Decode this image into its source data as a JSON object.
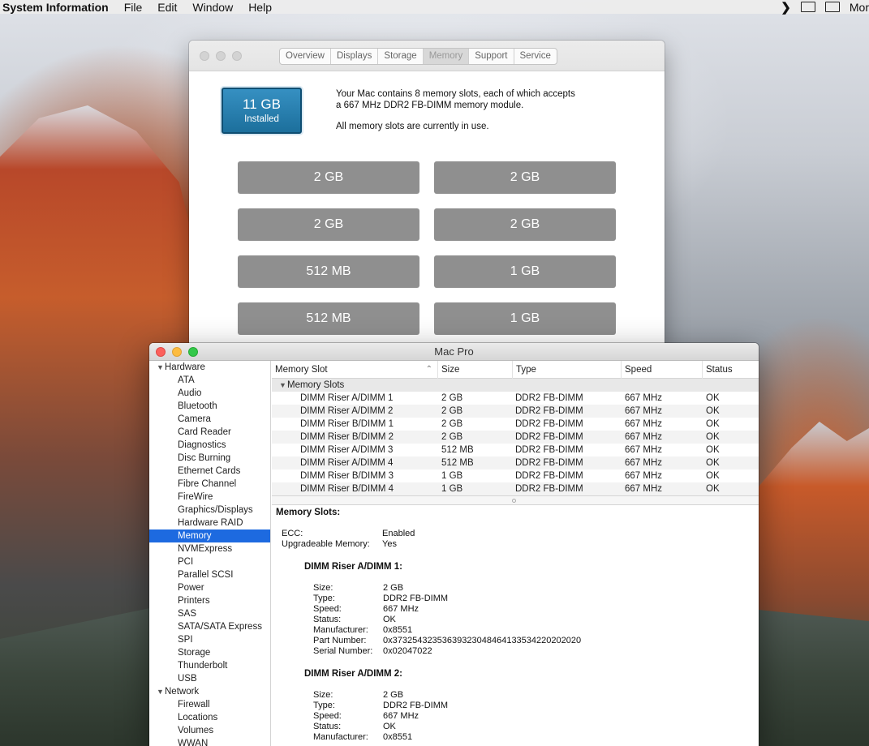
{
  "menubar": {
    "app_name": "System Information",
    "menus": [
      "File",
      "Edit",
      "Window",
      "Help"
    ],
    "right_text": "Mor"
  },
  "about": {
    "tabs": [
      "Overview",
      "Displays",
      "Storage",
      "Memory",
      "Support",
      "Service"
    ],
    "active_tab": "Memory",
    "badge_amount": "11 GB",
    "badge_label": "Installed",
    "desc_line1": "Your Mac contains 8 memory slots, each of which accepts",
    "desc_line2": "a 667 MHz DDR2 FB-DIMM memory module.",
    "desc_line3": "All memory slots are currently in use.",
    "slots": [
      "2 GB",
      "2 GB",
      "2 GB",
      "2 GB",
      "512 MB",
      "1 GB",
      "512 MB",
      "1 GB"
    ]
  },
  "sysinfo": {
    "window_title": "Mac Pro",
    "sidebar": {
      "hardware_label": "Hardware",
      "hardware_items": [
        "ATA",
        "Audio",
        "Bluetooth",
        "Camera",
        "Card Reader",
        "Diagnostics",
        "Disc Burning",
        "Ethernet Cards",
        "Fibre Channel",
        "FireWire",
        "Graphics/Displays",
        "Hardware RAID",
        "Memory",
        "NVMExpress",
        "PCI",
        "Parallel SCSI",
        "Power",
        "Printers",
        "SAS",
        "SATA/SATA Express",
        "SPI",
        "Storage",
        "Thunderbolt",
        "USB"
      ],
      "selected": "Memory",
      "network_label": "Network",
      "network_items": [
        "Firewall",
        "Locations",
        "Volumes",
        "WWAN"
      ]
    },
    "columns": [
      "Memory Slot",
      "Size",
      "Type",
      "Speed",
      "Status"
    ],
    "group_label": "Memory Slots",
    "rows": [
      [
        "DIMM Riser A/DIMM 1",
        "2 GB",
        "DDR2 FB-DIMM",
        "667 MHz",
        "OK"
      ],
      [
        "DIMM Riser A/DIMM 2",
        "2 GB",
        "DDR2 FB-DIMM",
        "667 MHz",
        "OK"
      ],
      [
        "DIMM Riser B/DIMM 1",
        "2 GB",
        "DDR2 FB-DIMM",
        "667 MHz",
        "OK"
      ],
      [
        "DIMM Riser B/DIMM 2",
        "2 GB",
        "DDR2 FB-DIMM",
        "667 MHz",
        "OK"
      ],
      [
        "DIMM Riser A/DIMM 3",
        "512 MB",
        "DDR2 FB-DIMM",
        "667 MHz",
        "OK"
      ],
      [
        "DIMM Riser A/DIMM 4",
        "512 MB",
        "DDR2 FB-DIMM",
        "667 MHz",
        "OK"
      ],
      [
        "DIMM Riser B/DIMM 3",
        "1 GB",
        "DDR2 FB-DIMM",
        "667 MHz",
        "OK"
      ],
      [
        "DIMM Riser B/DIMM 4",
        "1 GB",
        "DDR2 FB-DIMM",
        "667 MHz",
        "OK"
      ]
    ],
    "detail": {
      "heading": "Memory Slots:",
      "ecc_label": "ECC:",
      "ecc_value": "Enabled",
      "upgradeable_label": "Upgradeable Memory:",
      "upgradeable_value": "Yes",
      "dimms": [
        {
          "title": "DIMM Riser A/DIMM 1:",
          "fields": [
            [
              "Size:",
              "2 GB"
            ],
            [
              "Type:",
              "DDR2 FB-DIMM"
            ],
            [
              "Speed:",
              "667 MHz"
            ],
            [
              "Status:",
              "OK"
            ],
            [
              "Manufacturer:",
              "0x8551"
            ],
            [
              "Part Number:",
              "0x37325432353639323048464133534220202020"
            ],
            [
              "Serial Number:",
              "0x02047022"
            ]
          ]
        },
        {
          "title": "DIMM Riser A/DIMM 2:",
          "fields": [
            [
              "Size:",
              "2 GB"
            ],
            [
              "Type:",
              "DDR2 FB-DIMM"
            ],
            [
              "Speed:",
              "667 MHz"
            ],
            [
              "Status:",
              "OK"
            ],
            [
              "Manufacturer:",
              "0x8551"
            ]
          ]
        }
      ]
    }
  }
}
